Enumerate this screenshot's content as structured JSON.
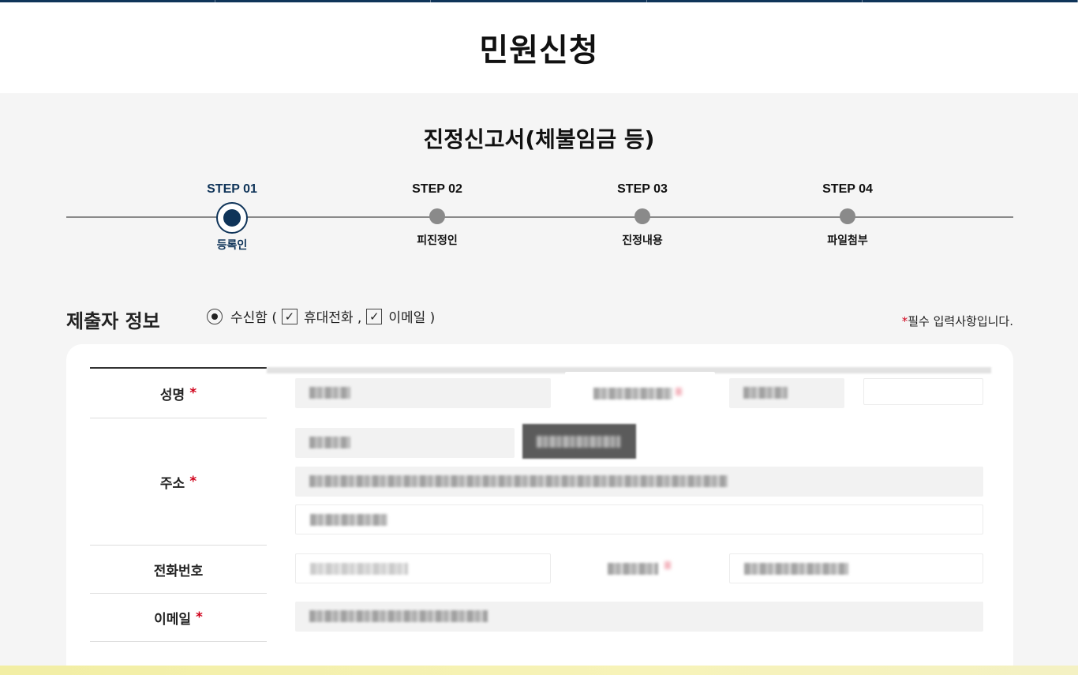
{
  "page": {
    "title": "민원신청"
  },
  "form": {
    "title": "진정신고서(체불임금 등)"
  },
  "steps": [
    {
      "no": "STEP 01",
      "name": "등록인",
      "active": true
    },
    {
      "no": "STEP 02",
      "name": "피진정인",
      "active": false
    },
    {
      "no": "STEP 03",
      "name": "진정내용",
      "active": false
    },
    {
      "no": "STEP 04",
      "name": "파일첨부",
      "active": false
    }
  ],
  "section": {
    "title": "제출자 정보",
    "required_star": "*",
    "required_note": "필수 입력사항입니다."
  },
  "rows": {
    "name": {
      "label": "성명",
      "star": "*"
    },
    "address": {
      "label": "주소",
      "star": "*"
    },
    "phone": {
      "label": "전화번호"
    },
    "email": {
      "label": "이메일",
      "star": "*"
    },
    "receive": {
      "radio_label": "수신함 (",
      "opt1": "휴대전화 ,",
      "opt2": "이메일 )"
    }
  },
  "colors": {
    "primary": "#0f3459",
    "required": "#d0021b",
    "step_inactive": "#8a8a8a"
  }
}
